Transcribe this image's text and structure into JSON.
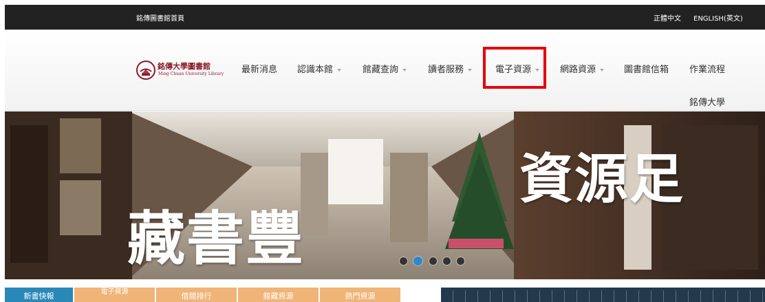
{
  "topbar": {
    "home_link": "銘傳圖書館首頁",
    "lang_zh": "正體中文",
    "lang_en": "ENGLISH(英文)"
  },
  "logo": {
    "name_zh": "銘傳大學圖書館",
    "name_en": "Ming Chuan University Library"
  },
  "nav": {
    "items": [
      {
        "label": "最新消息",
        "has_dropdown": false
      },
      {
        "label": "認識本館",
        "has_dropdown": true
      },
      {
        "label": "館藏查詢",
        "has_dropdown": true
      },
      {
        "label": "讀者服務",
        "has_dropdown": true
      },
      {
        "label": "電子資源",
        "has_dropdown": true,
        "highlighted": true
      },
      {
        "label": "網路資源",
        "has_dropdown": true
      },
      {
        "label": "圖書館信箱",
        "has_dropdown": false
      },
      {
        "label": "作業流程",
        "has_dropdown": false
      },
      {
        "label": "銘傳大學",
        "has_dropdown": false
      }
    ],
    "highlight_color": "#e8000b"
  },
  "hero": {
    "left_text": "藏書豐",
    "right_text": "資源足",
    "slide_count": 5,
    "active_slide": 2,
    "active_dot_color": "#2f86c8"
  },
  "tabs": {
    "items": [
      {
        "label": "新書快報",
        "active": true
      },
      {
        "label": "電子資源",
        "active": false
      },
      {
        "label": "借閱排行",
        "active": false
      },
      {
        "label": "館藏資源",
        "active": false
      },
      {
        "label": "熱門資源",
        "active": false
      }
    ],
    "active_color": "#2a88b8",
    "inactive_color": "#f0b477"
  }
}
